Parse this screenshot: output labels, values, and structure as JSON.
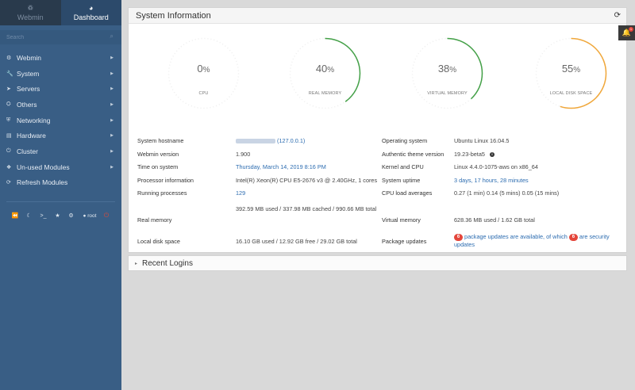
{
  "sidebar": {
    "tabs": [
      {
        "label": "Webmin",
        "icon": "webmin-logo-icon"
      },
      {
        "label": "Dashboard",
        "icon": "dashboard-icon"
      }
    ],
    "search_placeholder": "Search",
    "items": [
      {
        "label": "Webmin",
        "icon": "gear-icon",
        "arrow": true
      },
      {
        "label": "System",
        "icon": "wrench-icon",
        "arrow": true
      },
      {
        "label": "Servers",
        "icon": "rocket-icon",
        "arrow": true
      },
      {
        "label": "Others",
        "icon": "gears-icon",
        "arrow": true
      },
      {
        "label": "Networking",
        "icon": "shield-icon",
        "arrow": true
      },
      {
        "label": "Hardware",
        "icon": "hdd-icon",
        "arrow": true
      },
      {
        "label": "Cluster",
        "icon": "power-icon",
        "arrow": true
      },
      {
        "label": "Un-used Modules",
        "icon": "puzzle-icon",
        "arrow": true
      },
      {
        "label": "Refresh Modules",
        "icon": "refresh-icon",
        "arrow": false
      }
    ],
    "bottom": {
      "user": "root"
    }
  },
  "system_info": {
    "title": "System Information",
    "gauges": [
      {
        "value": "0",
        "unit": "%",
        "label": "CPU",
        "percent": 0,
        "color": "#4caf50"
      },
      {
        "value": "40",
        "unit": "%",
        "label": "REAL MEMORY",
        "percent": 40,
        "color": "#43a047"
      },
      {
        "value": "38",
        "unit": "%",
        "label": "VIRTUAL MEMORY",
        "percent": 38,
        "color": "#43a047"
      },
      {
        "value": "55",
        "unit": "%",
        "label": "LOCAL DISK SPACE",
        "percent": 55,
        "color": "#f0a73a"
      }
    ],
    "left": {
      "hostname_label": "System hostname",
      "hostname_value": "(127.0.0.1)",
      "webmin_version_label": "Webmin version",
      "webmin_version_value": "1.900",
      "time_label": "Time on system",
      "time_value": "Thursday, March 14, 2019 8:16 PM",
      "processor_label": "Processor information",
      "processor_value": "Intel(R) Xeon(R) CPU E5-2676 v3 @ 2.40GHz, 1 cores",
      "processes_label": "Running processes",
      "processes_value": "129",
      "realmem_label": "Real memory",
      "realmem_value": "392.59 MB used / 337.98 MB cached / 990.66 MB total",
      "disk_label": "Local disk space",
      "disk_value": "16.10 GB used / 12.92 GB free / 29.02 GB total"
    },
    "right": {
      "os_label": "Operating system",
      "os_value": "Ubuntu Linux 16.04.5",
      "theme_label": "Authentic theme version",
      "theme_value": "19.23-beta5",
      "kernel_label": "Kernel and CPU",
      "kernel_value": "Linux 4.4.0-1075-aws on x86_64",
      "uptime_label": "System uptime",
      "uptime_value": "3 days, 17 hours, 28 minutes",
      "load_label": "CPU load averages",
      "load_value": "0.27 (1 min) 0.14 (5 mins) 0.05 (15 mins)",
      "vmem_label": "Virtual memory",
      "vmem_value": "628.36 MB used / 1.62 GB total",
      "updates_label": "Package updates",
      "updates_count1": "6",
      "updates_text1": "package updates are available, of which",
      "updates_count2": "6",
      "updates_text2": "are security updates"
    }
  },
  "recent_logins": {
    "title": "Recent Logins"
  },
  "notifications": {
    "count": "1"
  }
}
